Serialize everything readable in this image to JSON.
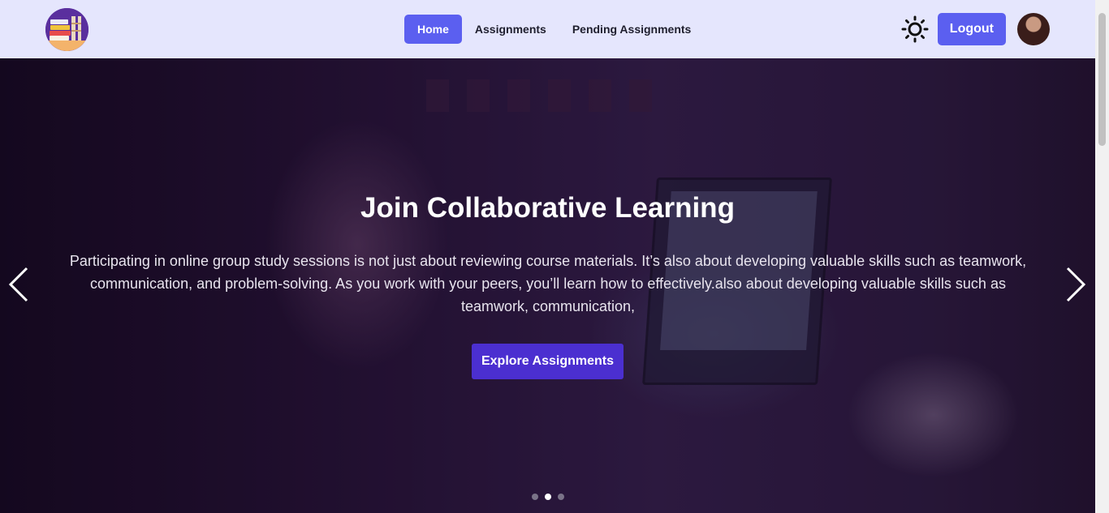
{
  "navbar": {
    "logo_icon": "books-logo-icon",
    "links": [
      {
        "label": "Home",
        "active": true
      },
      {
        "label": "Assignments",
        "active": false
      },
      {
        "label": "Pending Assignments",
        "active": false
      }
    ],
    "theme_icon": "sun-icon",
    "logout_label": "Logout",
    "avatar_icon": "user-avatar"
  },
  "hero": {
    "title": "Join Collaborative Learning",
    "text": "Participating in online group study sessions is not just about reviewing course materials. It’s also about developing valuable skills such as teamwork, communication, and problem-solving. As you work with your peers, you’ll learn how to effectively.also about developing valuable skills such as teamwork, communication,",
    "cta_label": "Explore Assignments",
    "prev_icon": "chevron-left-icon",
    "next_icon": "chevron-right-icon",
    "slide_count": 3,
    "active_slide": 2
  },
  "colors": {
    "navbar_bg": "#e5e6fd",
    "accent": "#5b5ff0",
    "cta": "#4b2fd0"
  }
}
